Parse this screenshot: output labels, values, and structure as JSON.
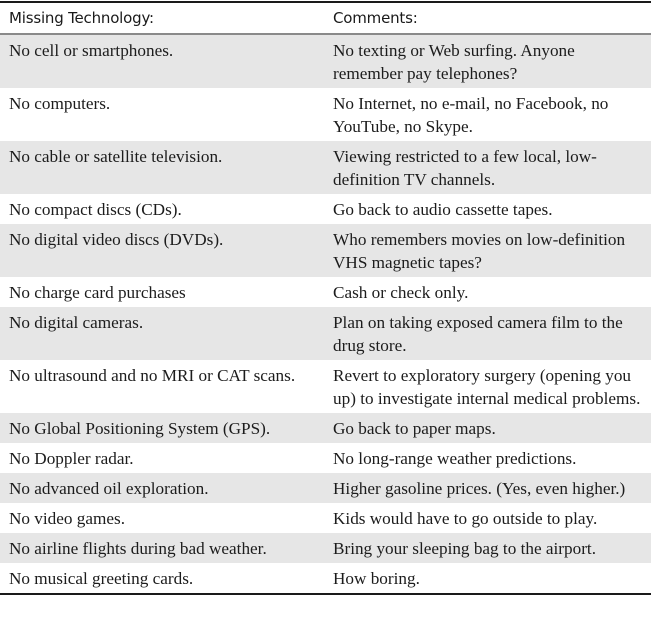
{
  "table": {
    "headers": [
      "Missing Technology:",
      "Comments:"
    ],
    "rows": [
      {
        "technology": "No cell or smartphones.",
        "comment": "No texting or Web surfing. Anyone remember pay telephones?"
      },
      {
        "technology": "No computers.",
        "comment": "No Internet, no e-mail, no Facebook, no YouTube, no Skype."
      },
      {
        "technology": "No cable or satellite television.",
        "comment": "Viewing restricted to a few local, low-definition TV channels."
      },
      {
        "technology": "No compact discs (CDs).",
        "comment": "Go back to audio cassette tapes."
      },
      {
        "technology": "No digital video discs (DVDs).",
        "comment": "Who remembers movies on low-definition VHS magnetic tapes?"
      },
      {
        "technology": "No charge card purchases",
        "comment": "Cash or check only."
      },
      {
        "technology": "No digital cameras.",
        "comment": "Plan on taking exposed camera film to the drug store."
      },
      {
        "technology": "No ultrasound and no MRI or CAT scans.",
        "comment": "Revert to exploratory surgery (opening you up) to investigate internal medical problems."
      },
      {
        "technology": "No Global Positioning System (GPS).",
        "comment": "Go back to paper maps."
      },
      {
        "technology": "No Doppler radar.",
        "comment": "No long-range weather predictions."
      },
      {
        "technology": "No advanced oil exploration.",
        "comment": "Higher gasoline prices. (Yes, even higher.)"
      },
      {
        "technology": "No video games.",
        "comment": "Kids would have to go outside to play."
      },
      {
        "technology": "No airline flights during bad weather.",
        "comment": "Bring your sleeping bag to the airport."
      },
      {
        "technology": "No musical greeting cards.",
        "comment": "How boring."
      }
    ]
  },
  "colors": {
    "shaded_row": "#e6e6e6",
    "rule": "#1a1a1a",
    "header_rule": "#8a8a8a"
  }
}
